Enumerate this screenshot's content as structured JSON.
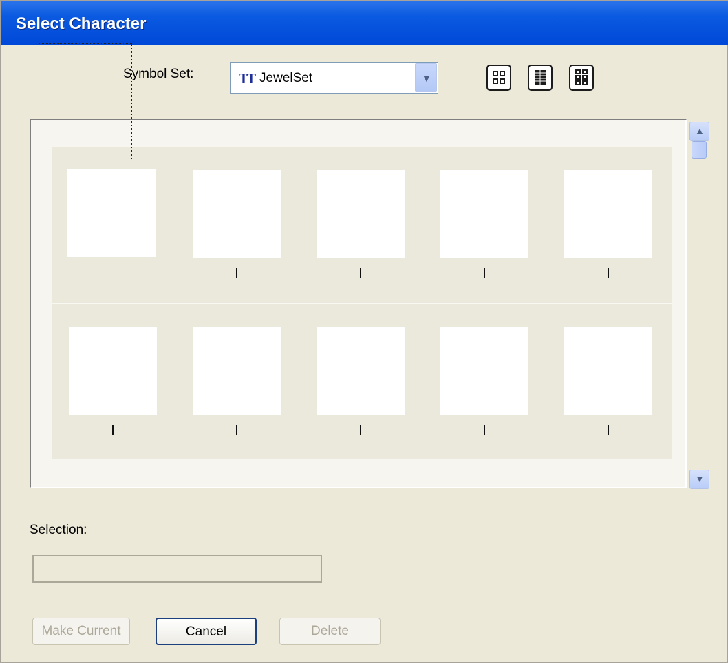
{
  "window": {
    "title": "Select Character"
  },
  "symbol_set": {
    "label": "Symbol Set:",
    "icon": "truetype-font-icon",
    "icon_text": "TT",
    "value": "JewelSet"
  },
  "view_buttons": [
    {
      "icon": "large-grid-view-icon"
    },
    {
      "icon": "list-view-icon"
    },
    {
      "icon": "small-grid-view-icon"
    }
  ],
  "characters": {
    "rows": [
      [
        "",
        "I",
        "I",
        "I",
        "I"
      ],
      [
        "I",
        "I",
        "I",
        "I",
        "I"
      ]
    ],
    "selected_index": 0
  },
  "selection": {
    "label": "Selection:",
    "value": ""
  },
  "buttons": {
    "make_current": "Make Current",
    "cancel": "Cancel",
    "delete": "Delete"
  },
  "colors": {
    "titlebar": "#0a5ae0",
    "dialog_bg": "#ece9d8"
  }
}
